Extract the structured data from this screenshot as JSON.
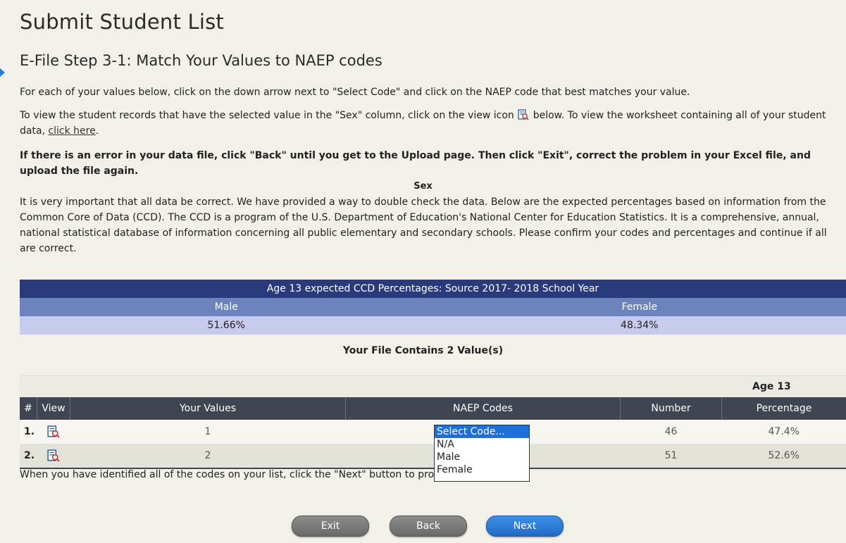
{
  "page_title": "Submit Student List",
  "step_title": "E-File Step 3-1: Match Your Values to NAEP codes",
  "instructions": {
    "p1": "For each of your values below, click on the down arrow next to \"Select Code\" and click on the NAEP code that best matches your value.",
    "p2_a": "To view the student records that have the selected value in the \"Sex\" column, click on the view icon",
    "p2_b": "below. To view the worksheet containing all of your student data,",
    "p2_link": "click here",
    "p2_end": ".",
    "p3": "If there is an error in your data file, click \"Back\" until you get to the Upload page. Then click \"Exit\", correct the problem in your Excel file, and upload the file again."
  },
  "section_heading": "Sex",
  "ccd_paragraph": "It is very important that all data be correct. We have provided a way to double check the data. Below are the expected percentages based on information from the Common Core of Data (CCD). The CCD is a program of the U.S. Department of Education's National Center for Education Statistics. It is a comprehensive, annual, national statistical database of information concerning all public elementary and secondary schools. Please confirm your codes and percentages and continue if all are correct.",
  "ccd_table": {
    "header": "Age 13 expected CCD Percentages: Source 2017- 2018 School Year",
    "columns": [
      "Male",
      "Female"
    ],
    "values": [
      "51.66%",
      "48.34%"
    ]
  },
  "file_contains": "Your File Contains 2 Value(s)",
  "age_group_label": "Age 13",
  "grid": {
    "headers": [
      "#",
      "View",
      "Your Values",
      "NAEP Codes",
      "Number",
      "Percentage"
    ],
    "rows": [
      {
        "index": "1.",
        "value": "1",
        "number": "46",
        "percentage": "47.4%"
      },
      {
        "index": "2.",
        "value": "2",
        "number": "51",
        "percentage": "52.6%"
      }
    ]
  },
  "dropdown": {
    "options": [
      "Select Code...",
      "N/A",
      "Male",
      "Female"
    ],
    "selected": "Select Code..."
  },
  "footer_note": "When you have identified all of the codes on your list, click the \"Next\" button to proceed.",
  "buttons": {
    "exit": "Exit",
    "back": "Back",
    "next": "Next"
  },
  "colors": {
    "ccd_header": "#283a7a",
    "ccd_subheader": "#6b82bd",
    "ccd_values": "#c6cbee",
    "grid_header": "#404552",
    "next_button": "#1f6cc8",
    "gray_button": "#6a6a6a",
    "dropdown_selected": "#1e6fd9"
  },
  "icons": {
    "view": "view-record-icon",
    "side_marker": "arrow-right-icon"
  }
}
